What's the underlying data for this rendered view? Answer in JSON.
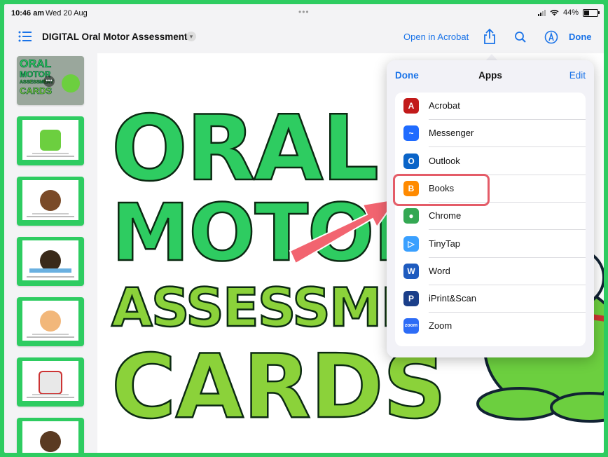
{
  "status_bar": {
    "time": "10:46 am",
    "date": "Wed 20 Aug",
    "battery": "44%",
    "battery_level": 0.44
  },
  "toolbar": {
    "list_icon": "list-icon",
    "doc_title": "DIGITAL Oral Motor Assessment",
    "open_in_acrobat": "Open in Acrobat",
    "share_icon": "share-icon",
    "search_icon": "search-icon",
    "markup_icon": "markup-icon",
    "done": "Done"
  },
  "page": {
    "lines": [
      "ORAL",
      "MOTOR",
      "ASSESSMENT",
      "CARDS"
    ]
  },
  "thumbnail_cover": {
    "lines": [
      "ORAL",
      "MOTOR",
      "ASSESSMENT",
      "CARDS"
    ]
  },
  "share_sheet": {
    "done": "Done",
    "title": "Apps",
    "edit": "Edit",
    "apps": [
      {
        "label": "Acrobat",
        "icon": "acrobat-icon",
        "color": "#c21a1a",
        "glyph": "A"
      },
      {
        "label": "Messenger",
        "icon": "messenger-icon",
        "color": "#1f6bff",
        "glyph": "~"
      },
      {
        "label": "Outlook",
        "icon": "outlook-icon",
        "color": "#0a64c8",
        "glyph": "O"
      },
      {
        "label": "Books",
        "icon": "books-icon",
        "color": "#ff8a00",
        "glyph": "B"
      },
      {
        "label": "Chrome",
        "icon": "chrome-icon",
        "color": "#34a853",
        "glyph": "●"
      },
      {
        "label": "TinyTap",
        "icon": "tinytap-icon",
        "color": "#3aa0ff",
        "glyph": "▷"
      },
      {
        "label": "Word",
        "icon": "word-icon",
        "color": "#1e5bbf",
        "glyph": "W"
      },
      {
        "label": "iPrint&Scan",
        "icon": "iprint-scan-icon",
        "color": "#1b3f8a",
        "glyph": "P"
      },
      {
        "label": "Zoom",
        "icon": "zoom-icon",
        "color": "#2d6cf6",
        "glyph": "zoom"
      }
    ]
  },
  "colors": {
    "accent": "#1a73e8",
    "highlight": "#e45c68",
    "card_green": "#2ecc61"
  }
}
